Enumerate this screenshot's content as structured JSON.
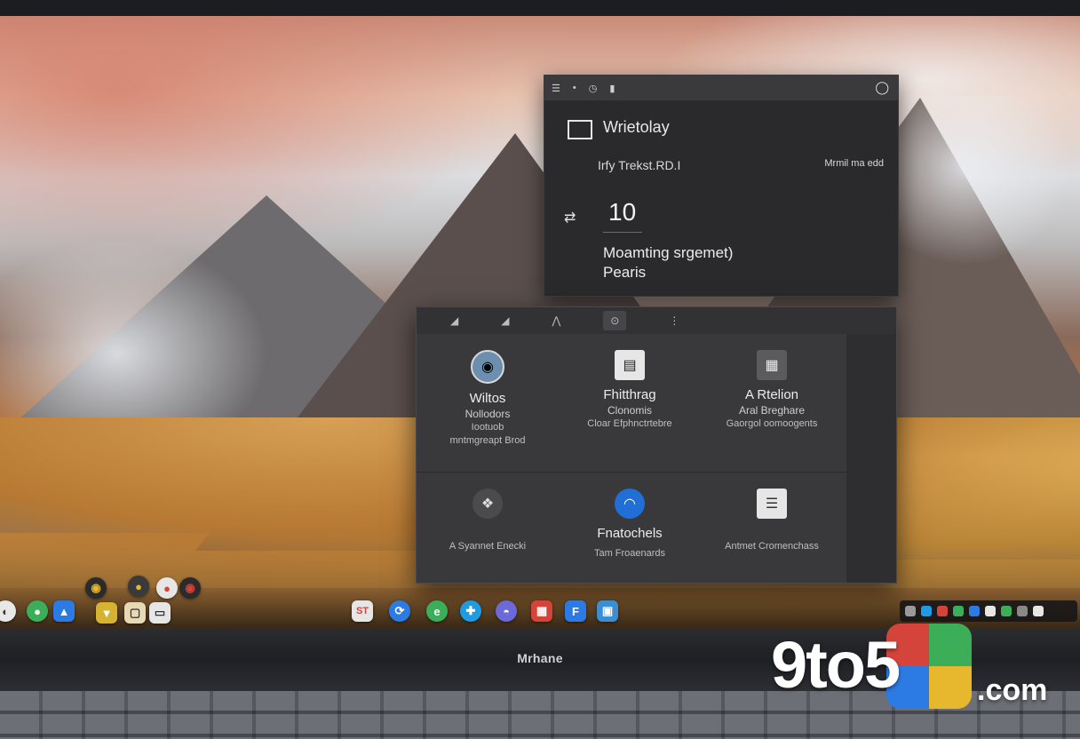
{
  "top_window": {
    "title": "Wrietolay",
    "subtitle": "Irfy  Trekst.RD.I",
    "meta": "Mrmil  ma edd",
    "number": "10",
    "line1": "Moamting srgemet)",
    "line2": "Pearis"
  },
  "grid_window": {
    "cells": [
      {
        "title": "Wiltos",
        "l2": "Nollodors",
        "l3": "Iootuob",
        "l4": "mntmgreapt Brod"
      },
      {
        "title": "Fhitthrag",
        "l2": "Clonomis",
        "l3": "Cloar Efphnctrtebre",
        "l4": ""
      },
      {
        "title": "A Rtelion",
        "l2": "Aral Breghare",
        "l3": "Gaorgol oomoogents",
        "l4": ""
      },
      {
        "title": "",
        "l2": "",
        "l3": "A Syannet Enecki",
        "l4": ""
      },
      {
        "title": "Fnatochels",
        "l2": "",
        "l3": "Tam Froaenards",
        "l4": ""
      },
      {
        "title": "",
        "l2": "",
        "l3": "Antmet Cromenchass",
        "l4": ""
      }
    ]
  },
  "laptop": {
    "brand": "Mrhane"
  },
  "watermark": {
    "text": "9to5",
    "suffix": ".com"
  },
  "dock": {
    "items": [
      "finder-icon",
      "maps-icon",
      "drive-icon",
      "shield-icon",
      "photos-icon",
      "calendar-icon",
      "safari-icon",
      "edge-icon",
      "mail-icon",
      "chrome-icon",
      "stack-icon",
      "fantastical-icon",
      "preview-icon"
    ],
    "colors": {
      "blue": "#2c7be5",
      "green": "#3cae5a",
      "red": "#d5443b",
      "yellow": "#e7b82d"
    }
  }
}
